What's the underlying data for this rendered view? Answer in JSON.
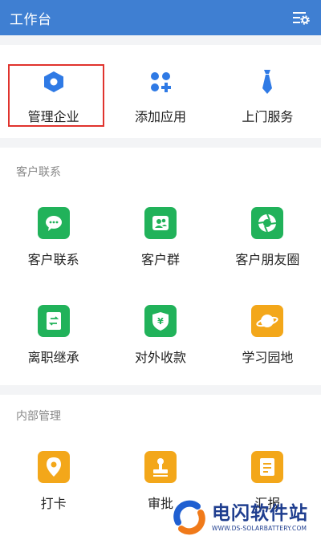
{
  "header": {
    "title": "工作台"
  },
  "top_actions": [
    {
      "label": "管理企业",
      "icon": "hexagon-icon"
    },
    {
      "label": "添加应用",
      "icon": "add-app-icon"
    },
    {
      "label": "上门服务",
      "icon": "tie-icon"
    }
  ],
  "customer": {
    "title": "客户联系",
    "items": [
      {
        "label": "客户联系",
        "icon": "chat-bubble-icon"
      },
      {
        "label": "客户群",
        "icon": "group-icon"
      },
      {
        "label": "客户朋友圈",
        "icon": "shutter-icon"
      },
      {
        "label": "离职继承",
        "icon": "transfer-doc-icon"
      },
      {
        "label": "对外收款",
        "icon": "yuan-shield-icon"
      },
      {
        "label": "学习园地",
        "icon": "planet-icon"
      }
    ]
  },
  "internal": {
    "title": "内部管理",
    "items": [
      {
        "label": "打卡",
        "icon": "location-pin-icon"
      },
      {
        "label": "审批",
        "icon": "stamp-icon"
      },
      {
        "label": "汇报",
        "icon": "report-doc-icon"
      }
    ]
  },
  "watermark": {
    "name": "电闪软件站",
    "url": "WWW.DS-SOLARBATTERY.COM"
  },
  "colors": {
    "header": "#3f7fd2",
    "accent_blue": "#2f7ae5",
    "green": "#21b25a",
    "orange": "#f3a71a",
    "highlight": "#e0332d"
  }
}
